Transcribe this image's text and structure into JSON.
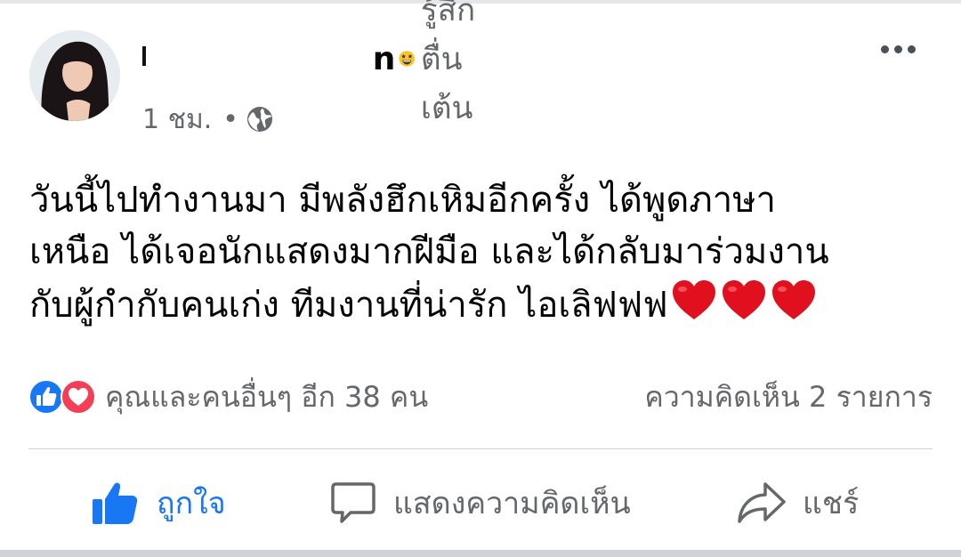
{
  "post": {
    "author_name_visible": "n",
    "feeling": "รู้สึกตื่นเต้น",
    "time": "1 ชม.",
    "separator": "•",
    "text_lines": [
      "วันนี้ไปทำงานมา มีพลังฮึกเหิมอีกครั้ง ได้พูดภาษา",
      "เหนือ ได้เจอนักแสดงมากฝีมือ และได้กลับมาร่วมงาน",
      "กับผู้กำกับคนเก่ง ทีมงานที่น่ารัก ไอเลิฟฟฟ"
    ],
    "icons": {
      "feeling": "star-struck-emoji-icon",
      "privacy": "globe-icon",
      "more": "more-options-icon",
      "hearts": "red-heart-emoji-icon"
    }
  },
  "reactions": {
    "summary": "คุณและคนอื่นๆ อีก 38 คน",
    "icons": [
      "like-reaction-icon",
      "love-reaction-icon"
    ],
    "comments": "ความคิดเห็น 2 รายการ"
  },
  "actions": {
    "like": "ถูกใจ",
    "comment": "แสดงความคิดเห็น",
    "share": "แชร์"
  },
  "colors": {
    "like_active": "#1877f2",
    "secondary_text": "#65676b",
    "love": "#f33e58",
    "heart": "#e0101e"
  }
}
